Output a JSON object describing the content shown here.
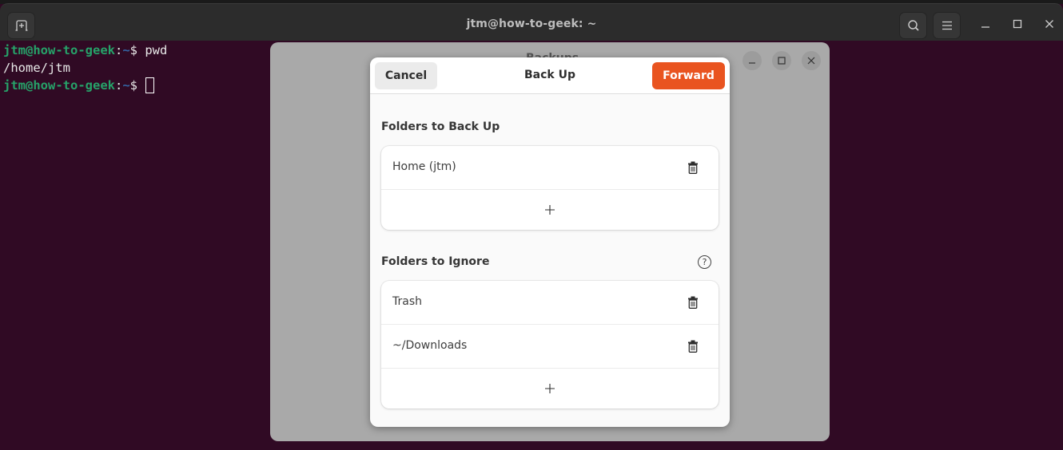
{
  "terminal": {
    "title": "jtm@how-to-geek: ~",
    "new_tab_icon": "new-tab-icon",
    "search_icon": "search-icon",
    "menu_icon": "hamburger-menu-icon",
    "lines": [
      {
        "user": "jtm@how-to-geek",
        "sep": ":",
        "path": "~",
        "prompt": "$ ",
        "cmd": "pwd"
      },
      {
        "output": "/home/jtm"
      },
      {
        "user": "jtm@how-to-geek",
        "sep": ":",
        "path": "~",
        "prompt": "$ ",
        "cmd": ""
      }
    ],
    "colors": {
      "background": "#300a24",
      "user": "#26a269",
      "path": "#3465a4"
    }
  },
  "backups_window": {
    "title": "Backups"
  },
  "dialog": {
    "title": "Back Up",
    "cancel_label": "Cancel",
    "forward_label": "Forward",
    "accent_color": "#e95420",
    "sections": [
      {
        "title": "Folders to Back Up",
        "items": [
          {
            "label": "Home (jtm)"
          }
        ],
        "add_label": "+"
      },
      {
        "title": "Folders to Ignore",
        "help_label": "?",
        "items": [
          {
            "label": "Trash"
          },
          {
            "label": "~/Downloads"
          }
        ],
        "add_label": "+"
      }
    ]
  }
}
